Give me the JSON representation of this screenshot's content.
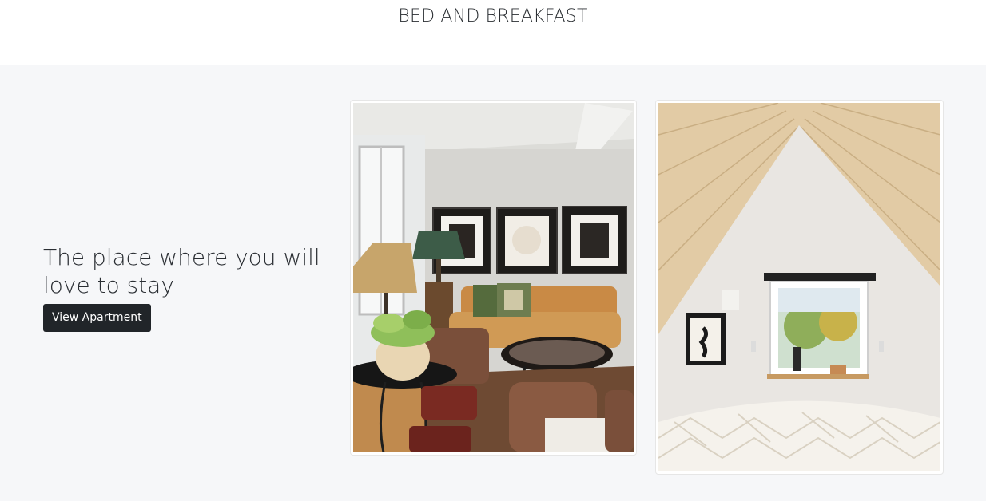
{
  "header": {
    "title": "BED AND BREAKFAST"
  },
  "hero": {
    "tagline": "The place where you will love to stay",
    "button_label": "View Apartment"
  },
  "photos": [
    {
      "subject": "living-room-photo"
    },
    {
      "subject": "attic-bedroom-photo"
    }
  ],
  "colors": {
    "hero_background": "#f6f7f9",
    "button_background": "#212529",
    "button_text": "#ffffff"
  }
}
